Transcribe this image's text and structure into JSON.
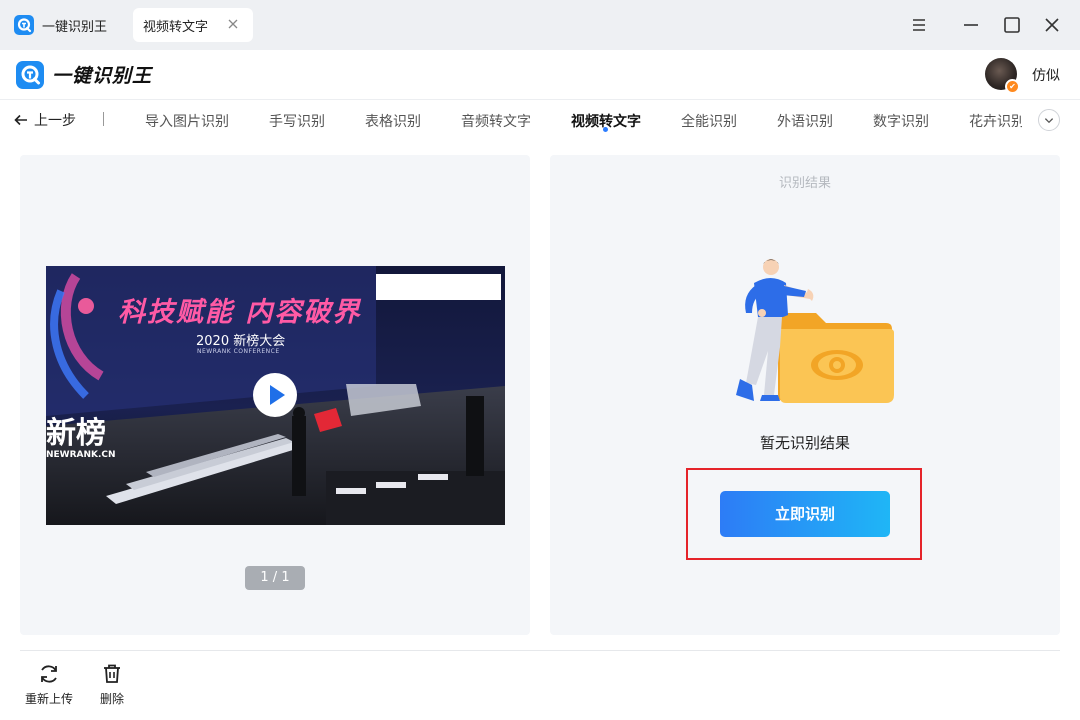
{
  "titlebar": {
    "app_tab_label": "一键识别王",
    "active_tab_label": "视频转文字"
  },
  "header": {
    "logo_text": "一键识别王",
    "user_name": "仿似"
  },
  "nav": {
    "back_label": "上一步",
    "items": [
      {
        "label": "导入图片识别",
        "active": false
      },
      {
        "label": "手写识别",
        "active": false
      },
      {
        "label": "表格识别",
        "active": false
      },
      {
        "label": "音频转文字",
        "active": false
      },
      {
        "label": "视频转文字",
        "active": true
      },
      {
        "label": "全能识别",
        "active": false
      },
      {
        "label": "外语识别",
        "active": false
      },
      {
        "label": "数字识别",
        "active": false
      },
      {
        "label": "花卉识别",
        "active": false
      }
    ]
  },
  "left_panel": {
    "video_stage_text": "科技赋能 内容破界",
    "video_subtitle": "2020 新榜大会",
    "video_subtitle_en": "NEWRANK CONFERENCE",
    "video_brand_text": "新榜",
    "video_brand_url": "NEWRANK.CN",
    "page_indicator": "1 / 1"
  },
  "right_panel": {
    "title": "识别结果",
    "empty_text": "暂无识别结果",
    "recognize_label": "立即识别"
  },
  "toolbar": {
    "reupload_label": "重新上传",
    "delete_label": "删除"
  },
  "colors": {
    "accent": "#2b7cff",
    "button_gradient_start": "#2d7cf6",
    "button_gradient_end": "#1fb6f6",
    "highlight": "#e5232a",
    "panel_bg": "#f4f6f9"
  },
  "icons": {
    "app": "app-logo-icon",
    "close_tab": "close-icon",
    "menu": "menu-icon",
    "minimize": "minimize-icon",
    "maximize": "maximize-icon",
    "close_window": "close-window-icon",
    "back": "arrow-left-icon",
    "more": "chevron-down-icon",
    "play": "play-icon",
    "reupload": "refresh-icon",
    "delete": "trash-icon"
  }
}
